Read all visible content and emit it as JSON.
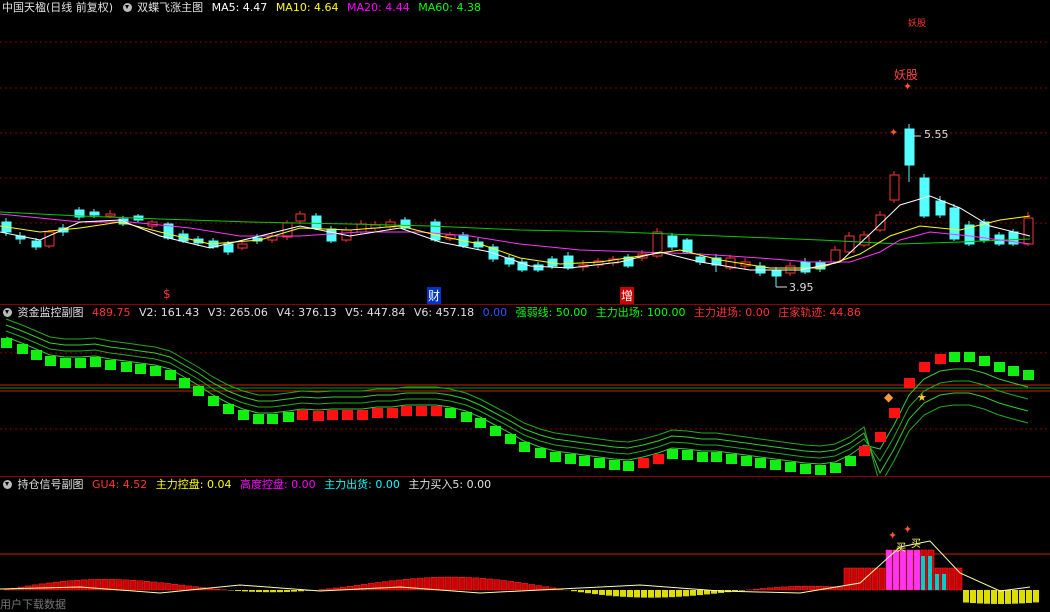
{
  "main": {
    "title": "中国天楹(日线 前复权)",
    "formula": "双蝶飞涨主图",
    "ma": [
      {
        "label": "MA5: 4.47",
        "color": "#ffffff"
      },
      {
        "label": "MA10: 4.64",
        "color": "#ffff00"
      },
      {
        "label": "MA20: 4.44",
        "color": "#ff00ff"
      },
      {
        "label": "MA60: 4.38",
        "color": "#00ff00"
      }
    ],
    "high_label": "5.55",
    "low_label": "3.95",
    "markers": {
      "a": "$",
      "b": "财",
      "c": "增",
      "d": "妖股",
      "e": "妖股"
    }
  },
  "sub1": {
    "title": "资金监控副图",
    "values": [
      {
        "label": "489.75",
        "color": "#ff3333"
      },
      {
        "label": "V2: 161.43",
        "color": "#e0e0e0"
      },
      {
        "label": "V3: 265.06",
        "color": "#e0e0e0"
      },
      {
        "label": "V4: 376.13",
        "color": "#e0e0e0"
      },
      {
        "label": "V5: 447.84",
        "color": "#e0e0e0"
      },
      {
        "label": "V6: 457.18",
        "color": "#e0e0e0"
      },
      {
        "label": "0.00",
        "color": "#3355ff"
      },
      {
        "label": "强弱线: 50.00",
        "color": "#00ff00"
      },
      {
        "label": "主力出场: 100.00",
        "color": "#00ff00"
      },
      {
        "label": "主力进场: 0.00",
        "color": "#ff3333"
      },
      {
        "label": "庄家轨迹: 44.86",
        "color": "#ff3333"
      }
    ]
  },
  "sub2": {
    "title": "持仓信号副图",
    "values": [
      {
        "label": "GU4: 4.52",
        "color": "#ff3333"
      },
      {
        "label": "主力控盘: 0.04",
        "color": "#ffff00"
      },
      {
        "label": "高度控盘: 0.00",
        "color": "#ff00ff"
      },
      {
        "label": "主力出货: 0.00",
        "color": "#00ffff"
      },
      {
        "label": "主力买入5: 0.00",
        "color": "#e0e0e0"
      }
    ],
    "buy_label": "买",
    "footer": "用户下载数据"
  },
  "chart_data": {
    "type": "candlestick",
    "high": 5.55,
    "low": 3.95,
    "ma": {
      "MA5": 4.47,
      "MA10": 4.64,
      "MA20": 4.44,
      "MA60": 4.38
    }
  }
}
